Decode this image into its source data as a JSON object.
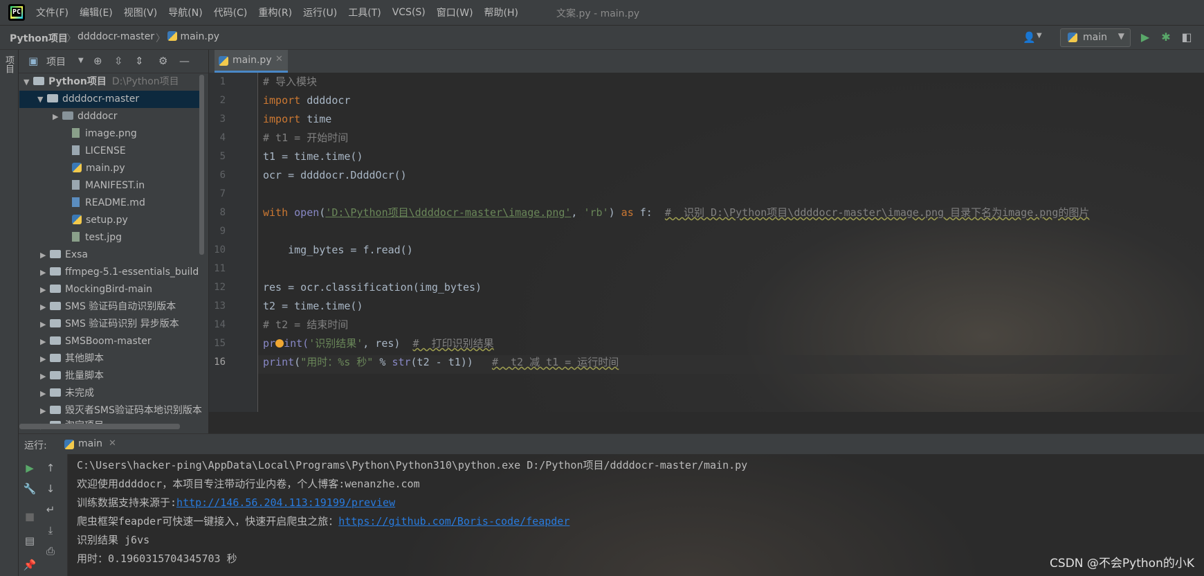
{
  "menubar": {
    "items": [
      "文件(F)",
      "编辑(E)",
      "视图(V)",
      "导航(N)",
      "代码(C)",
      "重构(R)",
      "运行(U)",
      "工具(T)",
      "VCS(S)",
      "窗口(W)",
      "帮助(H)"
    ],
    "window_title": "文案.py - main.py"
  },
  "breadcrumb": {
    "project": "Python项目",
    "folder": "ddddocr-master",
    "file": "main.py"
  },
  "toolbar": {
    "run_config": "main"
  },
  "left_stripe": {
    "label": "项目"
  },
  "project_panel": {
    "title": "项目",
    "root": {
      "name": "Python项目",
      "path": "D:\\Python项目"
    },
    "items": [
      {
        "name": "ddddocr-master"
      },
      {
        "name": "ddddocr"
      },
      {
        "name": "image.png"
      },
      {
        "name": "LICENSE"
      },
      {
        "name": "main.py"
      },
      {
        "name": "MANIFEST.in"
      },
      {
        "name": "README.md"
      },
      {
        "name": "setup.py"
      },
      {
        "name": "test.jpg"
      },
      {
        "name": "Exsa"
      },
      {
        "name": "ffmpeg-5.1-essentials_build"
      },
      {
        "name": "MockingBird-main"
      },
      {
        "name": "SMS 验证码自动识别版本"
      },
      {
        "name": "SMS 验证码识别 异步版本"
      },
      {
        "name": "SMSBoom-master"
      },
      {
        "name": "其他脚本"
      },
      {
        "name": "批量脚本"
      },
      {
        "name": "未完成"
      },
      {
        "name": "毁灭者SMS验证码本地识别版本"
      },
      {
        "name": "淘宝项目"
      }
    ]
  },
  "editor": {
    "tab": "main.py",
    "line_numbers": [
      "1",
      "2",
      "3",
      "4",
      "5",
      "6",
      "7",
      "8",
      "9",
      "10",
      "11",
      "12",
      "13",
      "14",
      "15",
      "16"
    ],
    "code": {
      "l1": "# 导入模块",
      "l2_kw": "import",
      "l2_rest": " ddddocr",
      "l3_kw": "import",
      "l3_rest": " time",
      "l4": "# t1 = 开始时间",
      "l5": "t1 = time.time()",
      "l6": "ocr = ddddocr.DdddOcr()",
      "l8_kw": "with",
      "l8_fn": "open",
      "l8_str1": "'D:\\Python项目\\ddddocr-master\\image.png'",
      "l8_mid": ", ",
      "l8_str2": "'rb'",
      "l8_as": "as",
      "l8_f": " f:  ",
      "l8_cm": "#  识别 D:\\Python项目\\ddddocr-master\\image.png 目录下名为image.png的图片",
      "l10": "    img_bytes = f.read()",
      "l12": "res = ocr.classification(img_bytes)",
      "l13": "t2 = time.time()",
      "l14": "# t2 = 结束时间",
      "l15_a": "pr",
      "l15_b": "int(",
      "l15_str": "'识别结果'",
      "l15_rest": ", res)  ",
      "l15_cm": "#  打印识别结果",
      "l16_fn": "print",
      "l16_str": "\"用时：%s 秒\"",
      "l16_mid": " % ",
      "l16_fn2": "str",
      "l16_rest": "(t2 - t1))   ",
      "l16_cm": "#  t2 减 t1 = 运行时间"
    }
  },
  "run_panel": {
    "label": "运行:",
    "tab": "main",
    "output": {
      "l1": "C:\\Users\\hacker-ping\\AppData\\Local\\Programs\\Python\\Python310\\python.exe D:/Python项目/ddddocr-master/main.py",
      "l2": "欢迎使用ddddocr，本项目专注带动行业内卷，个人博客:wenanzhe.com",
      "l3_text": "训练数据支持来源于:",
      "l3_link": "http://146.56.204.113:19199/preview",
      "l4_text": "爬虫框架feapder可快速一键接入，快速开启爬虫之旅：",
      "l4_link": "https://github.com/Boris-code/feapder",
      "l5": "识别结果 j6vs",
      "l6": "用时：0.1960315704345703 秒"
    }
  },
  "watermark": "CSDN @不会Python的小K"
}
